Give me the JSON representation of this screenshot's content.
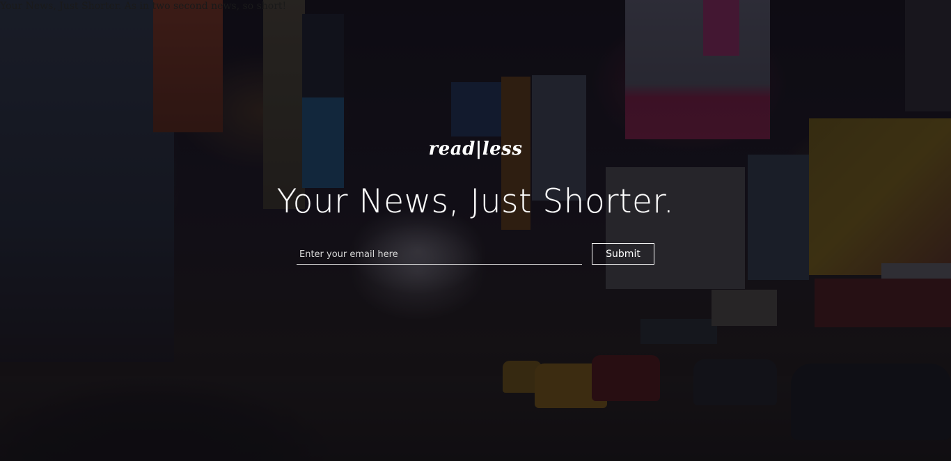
{
  "page": {
    "top_text": "Your News, Just Shorter. As in two second news, so short!",
    "brand": "read|less",
    "headline": "Your News, Just Shorter."
  },
  "signup": {
    "email_placeholder": "Enter your email here",
    "email_value": "",
    "submit_label": "Submit"
  },
  "colors": {
    "text": "#ffffff",
    "overlay": "rgba(10,8,14,0.55)"
  }
}
